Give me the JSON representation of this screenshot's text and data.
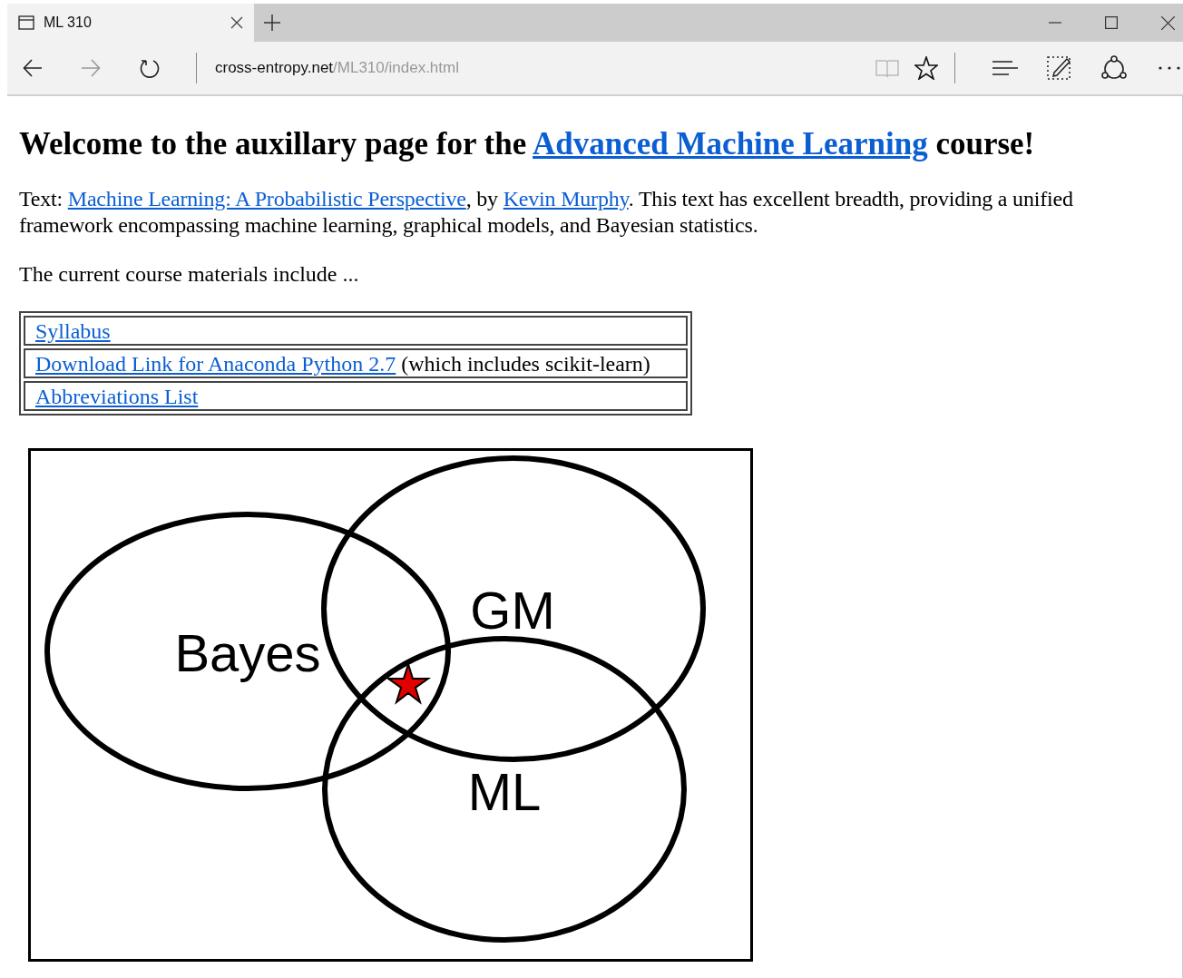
{
  "tab": {
    "title": "ML 310",
    "selected": true
  },
  "address": {
    "host": "cross-entropy.net",
    "path": "/ML310/index.html"
  },
  "heading": {
    "before": "Welcome to the auxillary page for the ",
    "link": "Advanced Machine Learning",
    "after": " course!"
  },
  "intro": [
    {
      "kind": "text",
      "text": "Text: "
    },
    {
      "kind": "link",
      "text": "Machine Learning: A Probabilistic Perspective"
    },
    {
      "kind": "text",
      "text": ", by "
    },
    {
      "kind": "link",
      "text": "Kevin Murphy"
    },
    {
      "kind": "text",
      "text": ". This text has excellent breadth, providing a unified framework encompassing machine learning, graphical models, and Bayesian statistics."
    }
  ],
  "materials_intro": "The current course materials include ...",
  "materials": [
    {
      "link": "Syllabus"
    },
    {
      "link": "Download Link for Anaconda Python 2.7",
      "note": "(which includes scikit-learn)"
    },
    {
      "link": "Abbreviations List"
    }
  ],
  "venn": {
    "labels": [
      "Bayes",
      "GM",
      "ML"
    ]
  }
}
